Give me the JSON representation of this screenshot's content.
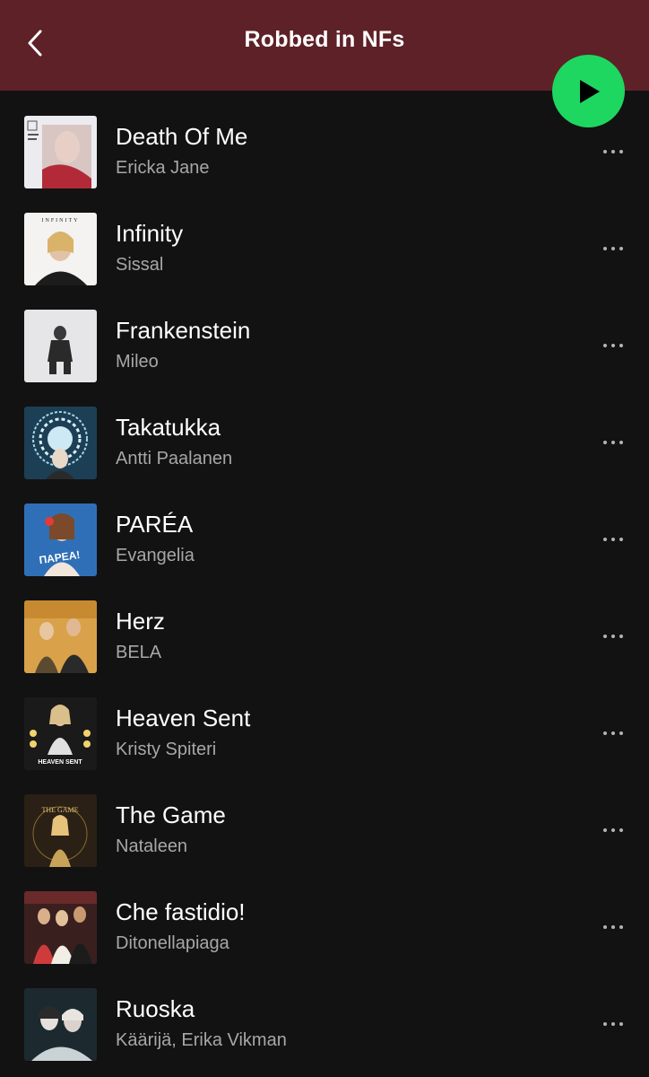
{
  "header": {
    "title": "Robbed in NFs",
    "back_icon": "chevron-left-icon",
    "play_icon": "play-icon",
    "bg_color": "#5e2128",
    "play_color": "#1ed760"
  },
  "tracks": [
    {
      "title": "Death Of Me",
      "artist": "Ericka Jane",
      "cover": [
        "#e9e9ee",
        "#b22a38"
      ]
    },
    {
      "title": "Infinity",
      "artist": "Sissal",
      "cover": [
        "#f4f3f1",
        "#1c1c1c"
      ],
      "cover_text": "INFINITY"
    },
    {
      "title": "Frankenstein",
      "artist": "Mileo",
      "cover": [
        "#e4e4e6",
        "#2a2a2a"
      ]
    },
    {
      "title": "Takatukka",
      "artist": "Antti Paalanen",
      "cover": [
        "#1d3f55",
        "#9fd2e6"
      ]
    },
    {
      "title": "PARÉA",
      "artist": "Evangelia",
      "cover": [
        "#2f6fb7",
        "#e63a36"
      ],
      "cover_text": "ΠΑΡΕΑ!"
    },
    {
      "title": "Herz",
      "artist": "BELA",
      "cover": [
        "#d9a24a",
        "#3a2a20"
      ]
    },
    {
      "title": "Heaven Sent",
      "artist": "Kristy Spiteri",
      "cover": [
        "#1a1a1a",
        "#d6d6d6"
      ],
      "cover_text": "HEAVEN SENT"
    },
    {
      "title": "The Game",
      "artist": "Nataleen",
      "cover": [
        "#2a2015",
        "#c9a25a"
      ],
      "cover_text": "THE GAME"
    },
    {
      "title": "Che fastidio!",
      "artist": "Ditonellapiaga",
      "cover": [
        "#3a1f1f",
        "#cf3b3b"
      ]
    },
    {
      "title": "Ruoska",
      "artist": "Käärijä, Erika Vikman",
      "cover": [
        "#1c2a30",
        "#c9d3d6"
      ]
    }
  ]
}
